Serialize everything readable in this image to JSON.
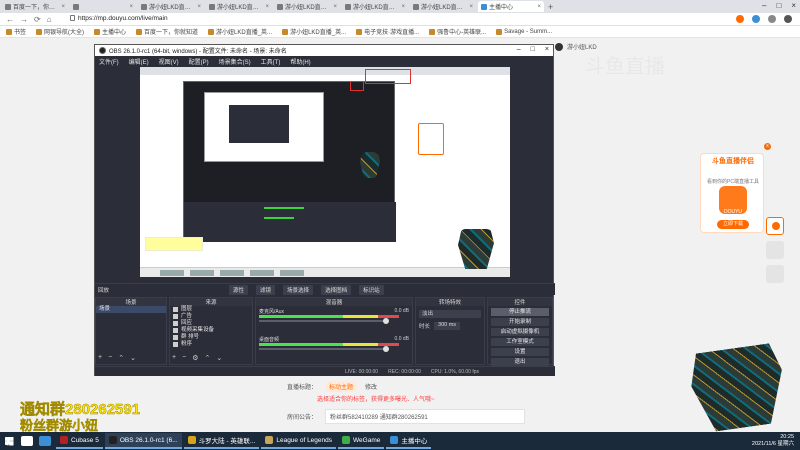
{
  "browser": {
    "tabs": [
      {
        "label": "百度一下，你就知道",
        "active": false
      },
      {
        "label": "",
        "active": false
      },
      {
        "label": "游小妞LKD直播_英雄联盟直播_斗鱼直",
        "active": false
      },
      {
        "label": "游小妞LKD直播_英雄联盟直播_斗鱼直",
        "active": false
      },
      {
        "label": "游小妞LKD直播_英雄联盟直播_斗鱼直",
        "active": false
      },
      {
        "label": "游小妞LKD直播_英雄联盟直播_斗鱼直",
        "active": false
      },
      {
        "label": "游小妞LKD直播_英雄联盟直播_斗鱼直",
        "active": false
      },
      {
        "label": "主播中心",
        "active": true
      }
    ],
    "new_tab": "+",
    "url": "https://mp.douyu.com/live/main",
    "bookmarks": [
      "书签",
      "网银导航(大全)",
      "主播中心",
      "百度一下，你就知道",
      "游小妞LKD直播_英...",
      "游小妞LKD直播_英...",
      "电子竞技·游戏直播...",
      "强鲁中心-英雄联...",
      "Savage - Summ..."
    ]
  },
  "page": {
    "room_owner": "游小妞LKD",
    "watermark": "斗鱼直播",
    "promo": {
      "title": "斗鱼直播伴侣",
      "subtitle": "看到你的PC端直播工具",
      "logo_text": "DOUYU",
      "button": "立即下载",
      "close": "x"
    },
    "form": {
      "label_title": "直播标题：",
      "title_value": "标动主题",
      "edit": "修改",
      "hint": "选择适合你的标签，获得更多曝光、人气哦~",
      "label_notice": "房间公告：",
      "notice_value": "粉丝群582410289 通知群280262591"
    },
    "overlay_line1": "通知群280262591",
    "overlay_line2": "粉丝群游小妞"
  },
  "obs": {
    "title": "OBS 26.1.0-rc1 (64-bit, windows) - 配置文件: 未命名 - 场景: 未命名",
    "menu": [
      "文件(F)",
      "编辑(E)",
      "视图(V)",
      "配置(P)",
      "场景集合(S)",
      "工具(T)",
      "帮助(H)"
    ],
    "controls_bar": {
      "left": "回放",
      "buttons": [
        "源性",
        "滤镜",
        "场景选择",
        "选择图档",
        "标识站"
      ]
    },
    "scenes": {
      "header": "场景",
      "items": [
        "场景"
      ]
    },
    "sources": {
      "header": "来源",
      "items": [
        "图层",
        "广告",
        "回应",
        "视频采集设备",
        "群 排号",
        "粉序"
      ]
    },
    "mixer": {
      "header": "混音器",
      "channels": [
        {
          "name": "麦克风/Aux",
          "db": "0.0 dB"
        },
        {
          "name": "桌面音频",
          "db": "0.0 dB"
        }
      ]
    },
    "transitions": {
      "header": "转场特效",
      "type": "淡出",
      "duration_label": "时长",
      "duration": "300 ms"
    },
    "controls": {
      "header": "控件",
      "buttons": [
        "停止推流",
        "开始录制",
        "启动虚拟摄像机",
        "工作室模式",
        "设置",
        "退出"
      ]
    },
    "status": [
      "LIVE: 00:00:00",
      "REC: 00:00:00",
      "CPU: 1.0%, 60.00 fps"
    ]
  },
  "taskbar": {
    "items": [
      {
        "label": "Cubase 5",
        "color": "#b22222",
        "active": false
      },
      {
        "label": "OBS 26.1.0-rc1 (6...",
        "color": "#222222",
        "active": true
      },
      {
        "label": "斗罗大陆 - 英雄联...",
        "color": "#d9a21b",
        "active": false
      },
      {
        "label": "League of Legends",
        "color": "#c7a55a",
        "active": false
      },
      {
        "label": "WeGame",
        "color": "#3fae49",
        "active": false
      },
      {
        "label": "主播中心",
        "color": "#3b8fd6",
        "active": false
      }
    ],
    "time": "20:25",
    "date": "2021/11/6 星期六"
  },
  "colors": {
    "accent": "#ff6a00",
    "obs_bg": "#2b2e38",
    "taskbar": "#1b2a3a",
    "overlay_text": "#ffe500"
  }
}
